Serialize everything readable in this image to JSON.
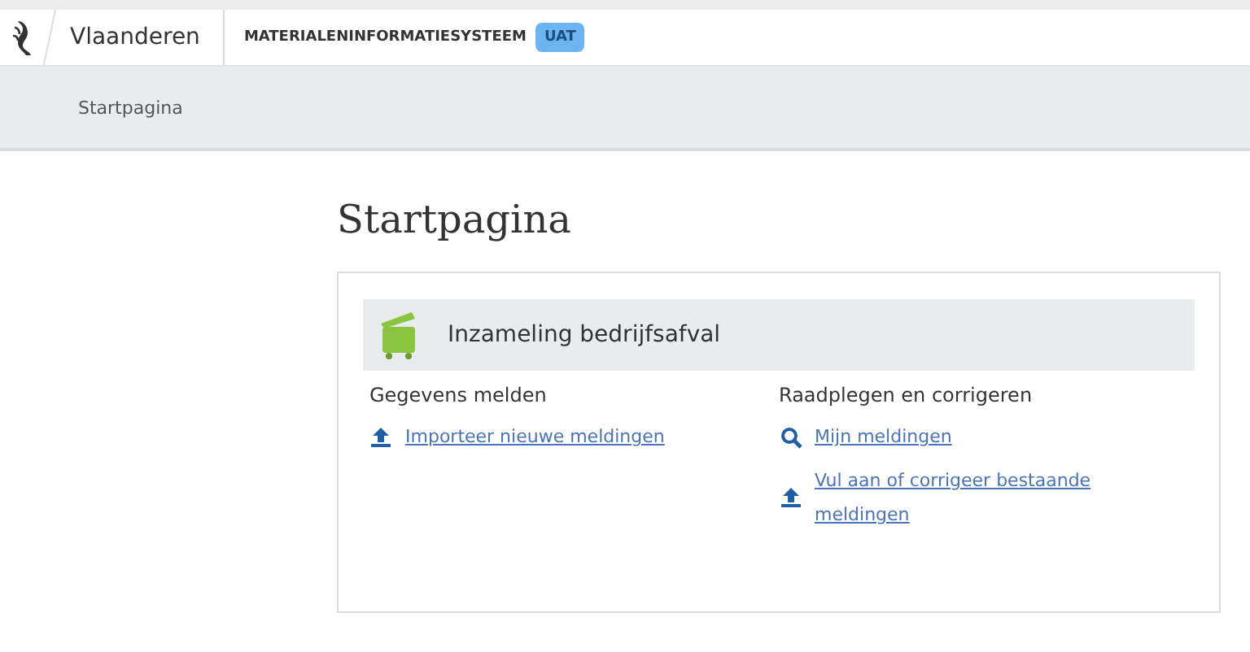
{
  "header": {
    "brand": "Vlaanderen",
    "app_name": "MATERIALENINFORMATIESYSTEEM",
    "env_badge": "UAT"
  },
  "breadcrumb": "Startpagina",
  "page_title": "Startpagina",
  "card": {
    "title": "Inzameling bedrijfsafval",
    "sections": [
      {
        "heading": "Gegevens melden",
        "links": [
          {
            "kind": "upload",
            "label": "Importeer nieuwe meldingen"
          }
        ]
      },
      {
        "heading": "Raadplegen en corrigeren",
        "links": [
          {
            "kind": "search",
            "label": "Mijn meldingen"
          },
          {
            "kind": "upload",
            "label": "Vul aan of corrigeer bestaande meldingen"
          }
        ]
      }
    ]
  }
}
